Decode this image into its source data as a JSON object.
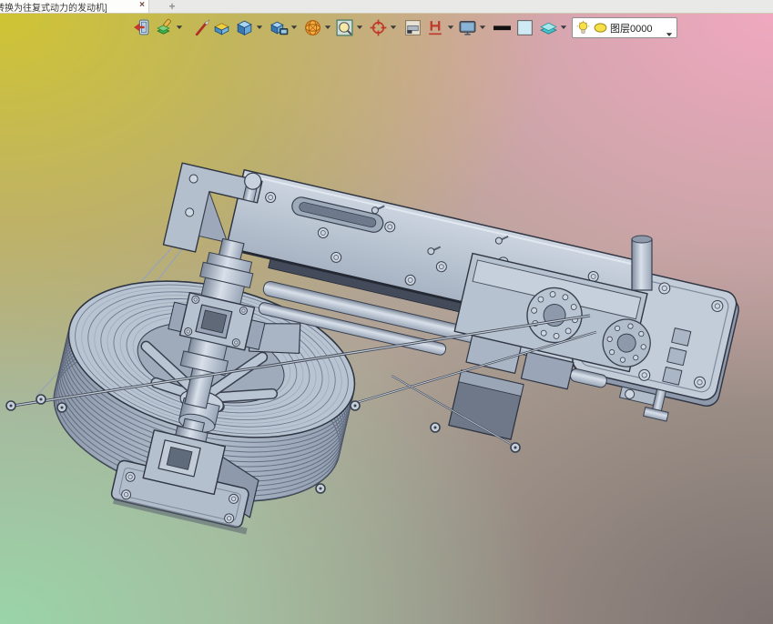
{
  "window": {
    "tab_title": "转换为往复式动力的发动机]",
    "close_label": "×",
    "new_tab_label": "+"
  },
  "toolbar": {
    "items": [
      {
        "name": "exit-render-button",
        "icon": "close-window-icon",
        "has_dropdown": false
      },
      {
        "name": "render-mode-button",
        "icon": "render-layers-icon",
        "has_dropdown": true
      },
      {
        "name": "brush-button",
        "icon": "brush-icon",
        "has_dropdown": false
      },
      {
        "name": "isometric-view-button",
        "icon": "isometric-box-icon",
        "has_dropdown": false
      },
      {
        "name": "solid-display-button",
        "icon": "solid-cube-icon",
        "has_dropdown": true
      },
      {
        "name": "shaded-display-button",
        "icon": "cube-display-icon",
        "has_dropdown": true
      },
      {
        "name": "wireframe-display-button",
        "icon": "wireframe-sphere-icon",
        "has_dropdown": true
      },
      {
        "name": "zoom-window-button",
        "icon": "zoom-window-icon",
        "has_dropdown": true
      },
      {
        "name": "locate-target-button",
        "icon": "target-icon",
        "has_dropdown": true
      },
      {
        "name": "insert-frame-button",
        "icon": "insert-frame-icon",
        "has_dropdown": false
      },
      {
        "name": "profile-beam-button",
        "icon": "steel-beam-icon",
        "has_dropdown": true
      },
      {
        "name": "display-settings-button",
        "icon": "monitor-icon",
        "has_dropdown": true
      },
      {
        "name": "line-width-button",
        "icon": "line-width-swatch",
        "has_dropdown": false
      },
      {
        "name": "color-picker-button",
        "icon": "color-swatch",
        "has_dropdown": false
      },
      {
        "name": "layers-button",
        "icon": "layers-stack-icon",
        "has_dropdown": true
      }
    ]
  },
  "layer_combo": {
    "current_layer": "图层0000",
    "icons": [
      "lightbulb-icon",
      "ellipse-color-icon"
    ]
  },
  "colors": {
    "bg_top_left": "#cfc433",
    "bg_top_right": "#f0a8c0",
    "bg_bottom_left": "#9ad4a8",
    "bg_bottom_right": "#7d7270",
    "bg_mid": "#b0a295",
    "model_body": "#b8c3d1",
    "model_edge": "#2f3542",
    "combo_bg": "#ffffff"
  }
}
